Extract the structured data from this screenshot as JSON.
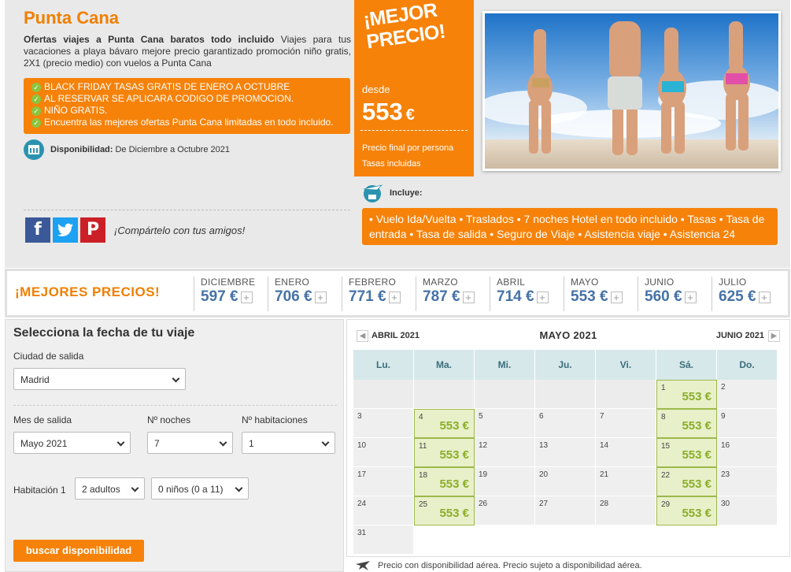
{
  "header": {
    "title": "Punta Cana",
    "desc_bold": "Ofertas viajes a Punta Cana baratos todo incluido",
    "desc_rest": " Viajes para tus vacaciones a playa bávaro mejore precio garantizado promoción niño gratis, 2X1 (precio medio) con vuelos a Punta Cana"
  },
  "offers": [
    "BLACK FRIDAY TASAS GRATIS DE ENERO A OCTUBRE",
    "AL RESERVAR SE APLICARA CODIGO DE PROMOCION.",
    "NIÑO GRATIS.",
    "Encuentra las mejores ofertas Punta Cana limitadas en todo incluido."
  ],
  "availability": {
    "label": "Disponibilidad:",
    "value": "De Diciembre a Octubre 2021"
  },
  "share": {
    "fb": "f",
    "tw": "t",
    "pi": "P",
    "text": "¡Compártelo con tus amigos!"
  },
  "price_box": {
    "badge": "¡MEJOR PRECIO!",
    "from": "desde",
    "amount": "553",
    "currency": "€",
    "note1": "Precio final por persona",
    "note2": "Tasas incluidas"
  },
  "includes": {
    "label": "Incluye:",
    "text": "• Vuelo Ida/Vuelta • Traslados • 7 noches Hotel en todo incluido • Tasas • Tasa de entrada • Tasa de salida • Seguro de Viaje • Asistencia viaje • Asistencia 24"
  },
  "month_bar": {
    "title": "¡MEJORES PRECIOS!",
    "months": [
      {
        "name": "DICIEMBRE",
        "price": "597 €"
      },
      {
        "name": "ENERO",
        "price": "706 €"
      },
      {
        "name": "FEBRERO",
        "price": "771 €"
      },
      {
        "name": "MARZO",
        "price": "787 €"
      },
      {
        "name": "ABRIL",
        "price": "714 €"
      },
      {
        "name": "MAYO",
        "price": "553 €"
      },
      {
        "name": "JUNIO",
        "price": "560 €"
      },
      {
        "name": "JULIO",
        "price": "625 €"
      }
    ],
    "plus": "+"
  },
  "form": {
    "title": "Selecciona la fecha de tu viaje",
    "city_label": "Ciudad de salida",
    "city_value": "Madrid",
    "month_label": "Mes de salida",
    "month_value": "Mayo 2021",
    "nights_label": "Nº noches",
    "nights_value": "7",
    "rooms_label": "Nº habitaciones",
    "rooms_value": "1",
    "room_label": "Habitación 1",
    "adults_value": "2 adultos",
    "kids_value": "0 niños (0 a 11)",
    "search_button": "buscar disponibilidad"
  },
  "calendar": {
    "prev": "ABRIL 2021",
    "current": "MAYO 2021",
    "next": "JUNIO 2021",
    "prev_arrow": "◀",
    "next_arrow": "▶",
    "days": [
      "Lu.",
      "Ma.",
      "Mi.",
      "Ju.",
      "Vi.",
      "Sá.",
      "Do."
    ],
    "weeks": [
      [
        null,
        null,
        null,
        null,
        null,
        {
          "d": "1",
          "p": "553 €"
        },
        {
          "d": "2"
        }
      ],
      [
        {
          "d": "3"
        },
        {
          "d": "4",
          "p": "553 €"
        },
        {
          "d": "5"
        },
        {
          "d": "6"
        },
        {
          "d": "7"
        },
        {
          "d": "8",
          "p": "553 €"
        },
        {
          "d": "9"
        }
      ],
      [
        {
          "d": "10"
        },
        {
          "d": "11",
          "p": "553 €"
        },
        {
          "d": "12"
        },
        {
          "d": "13"
        },
        {
          "d": "14"
        },
        {
          "d": "15",
          "p": "553 €"
        },
        {
          "d": "16"
        }
      ],
      [
        {
          "d": "17"
        },
        {
          "d": "18",
          "p": "553 €"
        },
        {
          "d": "19"
        },
        {
          "d": "20"
        },
        {
          "d": "21"
        },
        {
          "d": "22",
          "p": "553 €"
        },
        {
          "d": "23"
        }
      ],
      [
        {
          "d": "24"
        },
        {
          "d": "25",
          "p": "553 €"
        },
        {
          "d": "26"
        },
        {
          "d": "27"
        },
        {
          "d": "28"
        },
        {
          "d": "29",
          "p": "553 €"
        },
        {
          "d": "30"
        }
      ],
      [
        {
          "d": "31"
        }
      ]
    ],
    "footer": "Precio con disponibilidad aérea. Precio sujeto a disponibilidad aérea."
  },
  "colors": {
    "accent": "#f6820a",
    "price_blue": "#4672a7",
    "cal_green": "#8bad2a"
  },
  "icons": [
    "check-icon",
    "calendar-icon",
    "facebook-icon",
    "twitter-icon",
    "pinterest-icon",
    "plane-icon",
    "chevron-down-icon"
  ]
}
